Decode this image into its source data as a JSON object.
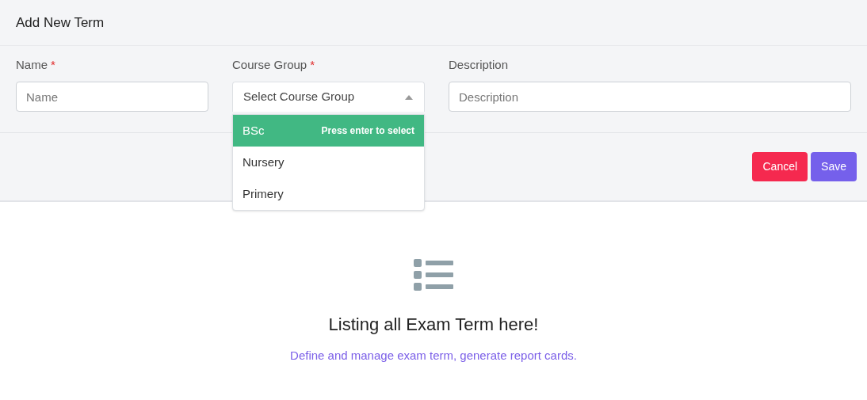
{
  "header": {
    "title": "Add New Term"
  },
  "fields": [
    {
      "kind": "text",
      "label": "Name",
      "required_mark": "*",
      "placeholder": "Name"
    },
    {
      "kind": "select",
      "label": "Course Group",
      "required_mark": "*",
      "placeholder": "Select Course Group",
      "expanded": true,
      "hint": "Press enter to select",
      "options": [
        {
          "label": "BSc",
          "selected": true
        },
        {
          "label": "Nursery",
          "selected": false
        },
        {
          "label": "Primery",
          "selected": false
        }
      ]
    },
    {
      "kind": "text",
      "label": "Description",
      "placeholder": "Description"
    }
  ],
  "buttons": [
    {
      "kind": "cancel",
      "label": "Cancel"
    },
    {
      "kind": "save",
      "label": "Save"
    }
  ],
  "empty_state": {
    "title": "Listing all Exam Term here!",
    "description": "Define and manage exam term, generate report cards."
  }
}
